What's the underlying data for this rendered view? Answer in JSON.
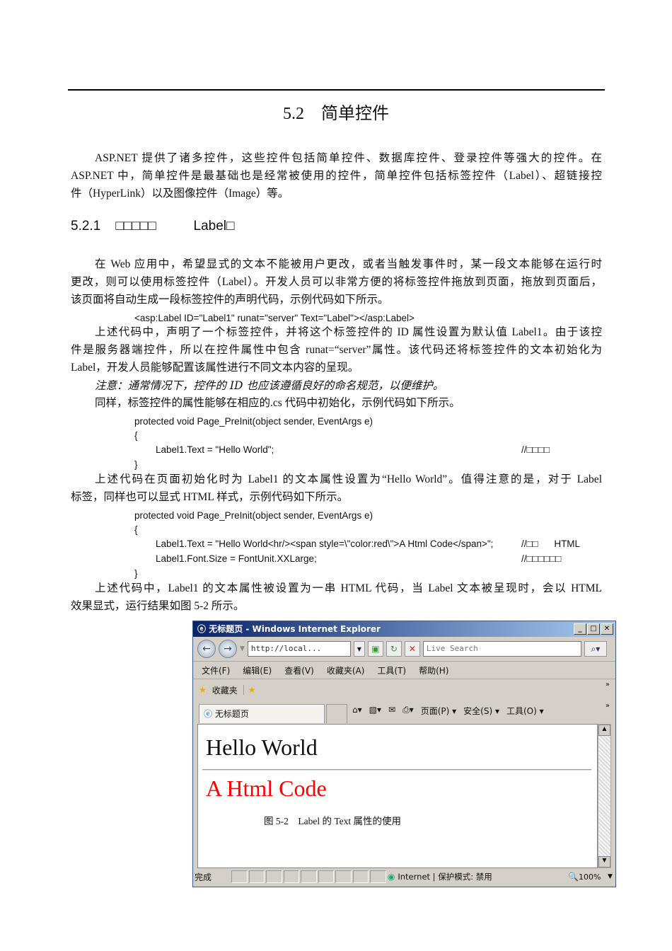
{
  "section_title": "5.2    简单控件",
  "para1": [
    "ASP.NET 提供了诸多控件，这些控件包括简单控件、数据库控件、登录控件等强大的控件。在",
    "ASP.NET 中，简单控件是最基础也是经常被使用的控件，简单控件包括标签控件（Label）、超链接控",
    "件（HyperLink）以及图像控件（Image）等。"
  ],
  "subsection_title": "5.2.1    □□□□□          Label□",
  "para2": [
    "在 Web 应用中，希望显式的文本不能被用户更改，或者当触发事件时，某一段文本能够在运行时",
    "更改，则可以使用标签控件（Label）。开发人员可以非常方便的将标签控件拖放到页面，拖放到页面后，",
    "该页面将自动生成一段标签控件的声明代码，示例代码如下所示。"
  ],
  "code1": "<asp:Label ID=\"Label1\" runat=\"server\" Text=\"Label\"></asp:Label>",
  "para3": [
    "上述代码中，声明了一个标签控件，并将这个标签控件的 ID 属性设置为默认值 Label1。由于该控",
    "件是服务器端控件，所以在控件属性中包含  runat=“server”属性。该代码还将标签控件的文本初始化为",
    "Label，开发人员能够配置该属性进行不同文本内容的呈现。"
  ],
  "note": "注意：通常情况下，控件的 ID 也应该遵循良好的命名规范，以便维护。",
  "para4": "同样，标签控件的属性能够在相应的.cs 代码中初始化，示例代码如下所示。",
  "code2": {
    "sig": "protected void Page_PreInit(object sender, EventArgs e)",
    "open": "{",
    "line": "Label1.Text = \"Hello World\";",
    "comment": "//□□□□",
    "close": "}"
  },
  "para5": [
    "上述代码在页面初始化时为 Label1 的文本属性设置为“Hello World”。值得注意的是，对于 Label",
    "标签，同样也可以显式 HTML 样式，示例代码如下所示。"
  ],
  "code3": {
    "sig": "protected void Page_PreInit(object sender, EventArgs e)",
    "open": "{",
    "line1": "Label1.Text = \"Hello World<hr/><span style=\\\"color:red\\\">A Html Code</span>\";",
    "comment1": "//□□      HTML",
    "line2": "Label1.Font.Size = FontUnit.XXLarge;",
    "comment2": "//□□□□□□",
    "close": "}"
  },
  "para6": [
    "上述代码中，Label1 的文本属性被设置为一串 HTML 代码，当 Label 文本被呈现时，会以 HTML",
    "效果显式，运行结果如图 5-2 所示。"
  ],
  "ie": {
    "title": "无标题页 - Windows Internet Explorer",
    "address": "http://local...",
    "search_placeholder": "Live Search",
    "menu": [
      "文件(F)",
      "编辑(E)",
      "查看(V)",
      "收藏夹(A)",
      "工具(T)",
      "帮助(H)"
    ],
    "favorites": "收藏夹",
    "tab": "无标题页",
    "commands": [
      "页面(P) ▾",
      "安全(S) ▾",
      "工具(O) ▾"
    ],
    "hello": "Hello World",
    "red_text": "A Html Code",
    "red_color": "#ff0000",
    "status": "完成",
    "zone": "Internet | 保护模式: 禁用",
    "zoom": "100%"
  },
  "caption": "图 5-2    Label 的 Text 属性的使用"
}
